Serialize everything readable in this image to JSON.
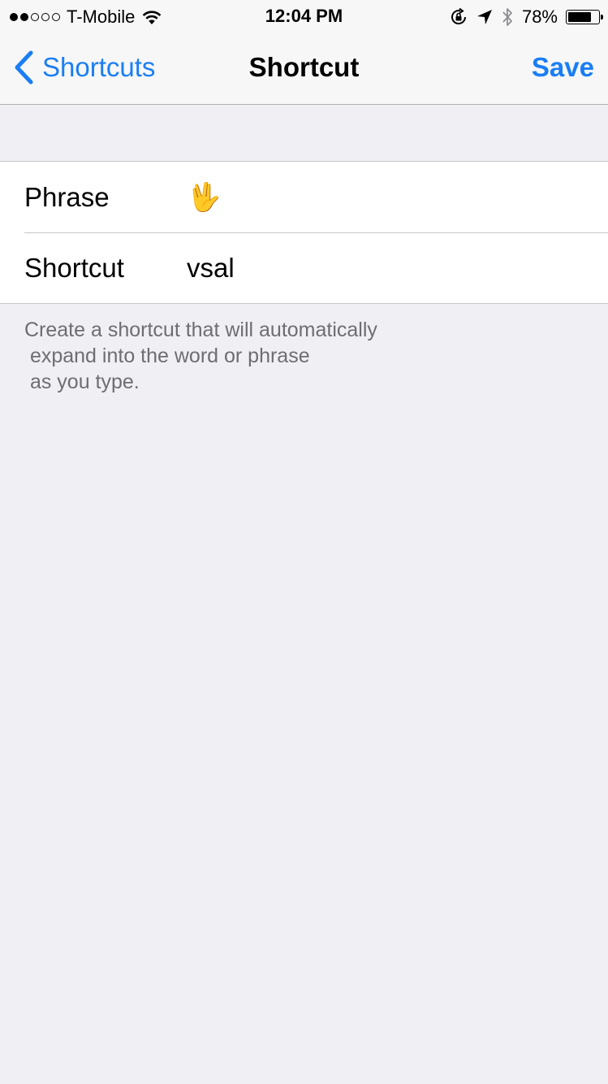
{
  "status_bar": {
    "carrier": "T-Mobile",
    "time": "12:04 PM",
    "battery_percent": "78%",
    "battery_level": 0.78,
    "signal_strength": 2,
    "signal_max": 5,
    "icons": [
      "wifi-icon",
      "orientation-lock-icon",
      "location-arrow-icon",
      "bluetooth-icon",
      "battery-icon"
    ]
  },
  "nav": {
    "back_label": "Shortcuts",
    "title": "Shortcut",
    "save_label": "Save",
    "accent_color": "#1a7ef5"
  },
  "form": {
    "phrase_label": "Phrase",
    "phrase_value": "🖖",
    "shortcut_label": "Shortcut",
    "shortcut_value": "vsal"
  },
  "footer": {
    "help_text": "Create a shortcut that will automatically\n expand into the word or phrase\n as you type."
  }
}
